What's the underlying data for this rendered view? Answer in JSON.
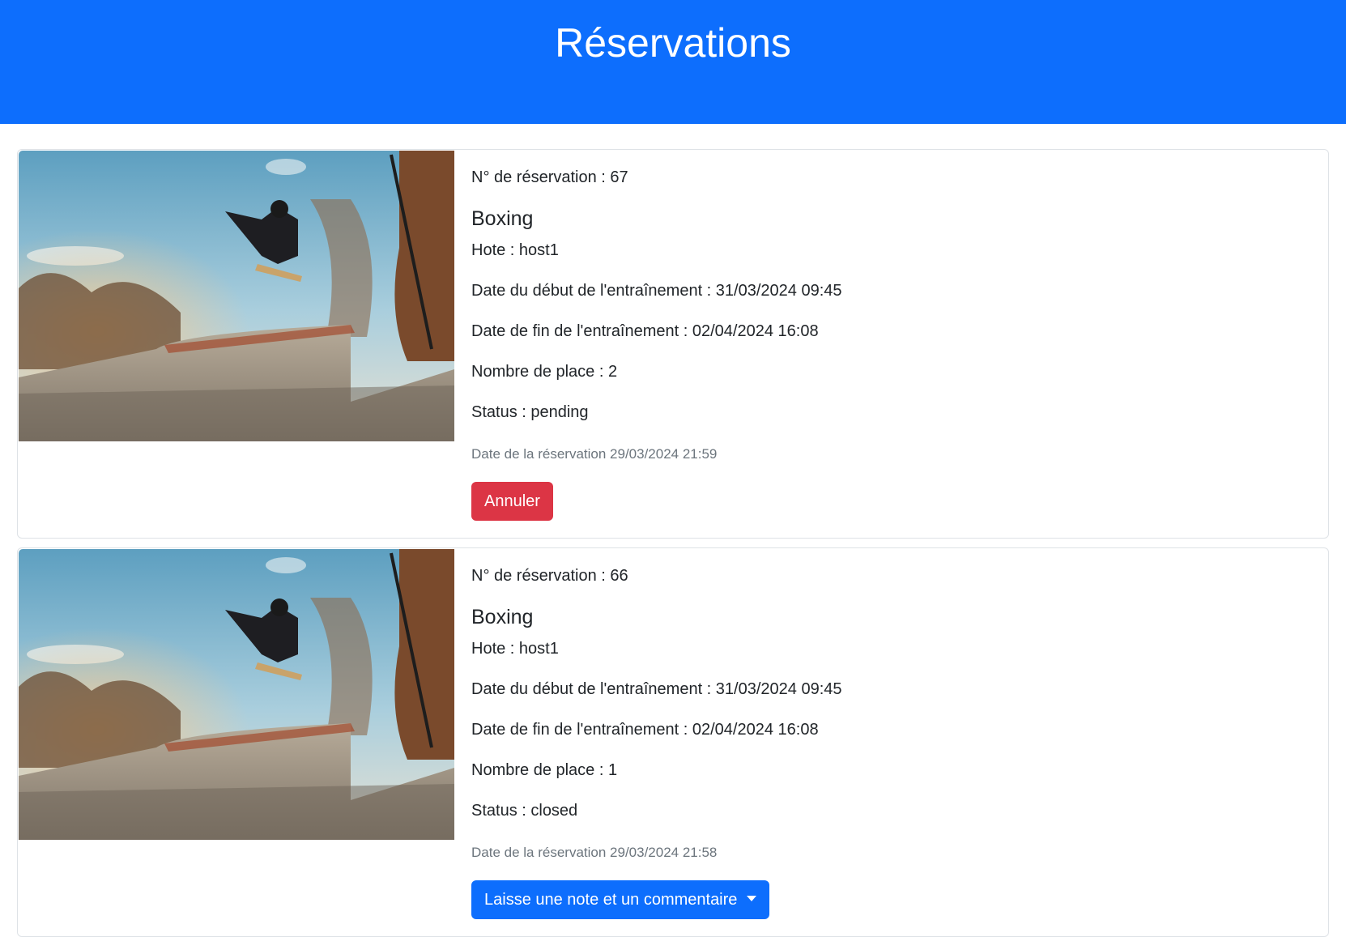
{
  "header": {
    "title": "Réservations"
  },
  "reservations": [
    {
      "number_text": "N° de réservation : 67",
      "title": "Boxing",
      "host_text": "Hote : host1",
      "start_text": "Date du début de l'entraînement : 31/03/2024 09:45",
      "end_text": "Date de fin de l'entraînement : 02/04/2024 16:08",
      "places_text": "Nombre de place : 2",
      "status_text": "Status : pending",
      "booked_text": "Date de la réservation 29/03/2024 21:59",
      "action_label": "Annuler"
    },
    {
      "number_text": "N° de réservation : 66",
      "title": "Boxing",
      "host_text": "Hote : host1",
      "start_text": "Date du début de l'entraînement : 31/03/2024 09:45",
      "end_text": "Date de fin de l'entraînement : 02/04/2024 16:08",
      "places_text": "Nombre de place : 1",
      "status_text": "Status : closed",
      "booked_text": "Date de la réservation 29/03/2024 21:58",
      "action_label": "Laisse une note et un commentaire"
    }
  ],
  "colors": {
    "primary": "#0d6efd",
    "danger": "#dc3545",
    "muted": "#6c757d"
  },
  "icons": {
    "dropdown": "caret-down-icon"
  }
}
